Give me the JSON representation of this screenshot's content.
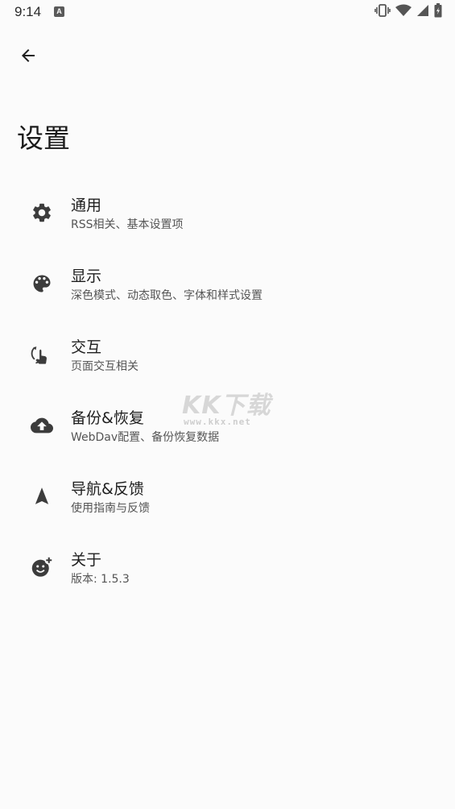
{
  "status_bar": {
    "time": "9:14",
    "app_icon_letter": "A"
  },
  "header": {
    "back_icon": "arrow-back-icon",
    "title": "设置"
  },
  "settings": {
    "items": [
      {
        "icon": "gear-icon",
        "label": "通用",
        "description": "RSS相关、基本设置项"
      },
      {
        "icon": "palette-icon",
        "label": "显示",
        "description": "深色模式、动态取色、字体和样式设置"
      },
      {
        "icon": "touch-gesture-icon",
        "label": "交互",
        "description": "页面交互相关"
      },
      {
        "icon": "cloud-upload-icon",
        "label": "备份&恢复",
        "description": "WebDav配置、备份恢复数据"
      },
      {
        "icon": "navigation-arrow-icon",
        "label": "导航&反馈",
        "description": "使用指南与反馈"
      },
      {
        "icon": "add-reaction-icon",
        "label": "关于",
        "description": "版本: 1.5.3"
      }
    ]
  },
  "watermark": {
    "logo": "KK下载",
    "url": "www.kkx.net"
  },
  "colors": {
    "background": "#fbfbfb",
    "icon": "#3c3c3c",
    "text_primary": "#1e1e1e",
    "text_secondary": "#555555"
  }
}
